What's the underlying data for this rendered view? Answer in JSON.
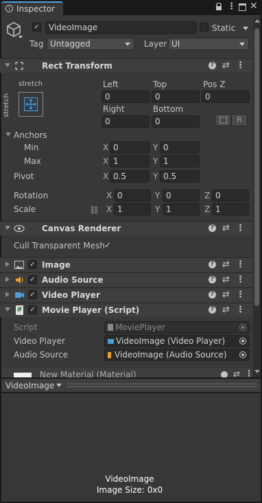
{
  "tab": {
    "title": "Inspector"
  },
  "object": {
    "name": "VideoImage",
    "static_label": "Static",
    "tag_label": "Tag",
    "tag_value": "Untagged",
    "layer_label": "Layer",
    "layer_value": "UI",
    "active": true
  },
  "rect_transform": {
    "title": "Rect Transform",
    "stretch_h": "stretch",
    "stretch_v": "stretch",
    "left_label": "Left",
    "left": "0",
    "top_label": "Top",
    "top": "0",
    "posz_label": "Pos Z",
    "posz": "0",
    "right_label": "Right",
    "right": "0",
    "bottom_label": "Bottom",
    "bottom": "0",
    "raw_button": "R",
    "anchors_label": "Anchors",
    "min_label": "Min",
    "min_x": "0",
    "min_y": "0",
    "max_label": "Max",
    "max_x": "1",
    "max_y": "1",
    "pivot_label": "Pivot",
    "pivot_x": "0.5",
    "pivot_y": "0.5",
    "rotation_label": "Rotation",
    "rot_x": "0",
    "rot_y": "0",
    "rot_z": "0",
    "scale_label": "Scale",
    "scale_x": "1",
    "scale_y": "1",
    "scale_z": "1",
    "x": "X",
    "y": "Y",
    "z": "Z"
  },
  "canvas_renderer": {
    "title": "Canvas Renderer",
    "cull_label": "Cull Transparent Mesh",
    "cull_checked": true
  },
  "components": [
    {
      "title": "Image"
    },
    {
      "title": "Audio Source"
    },
    {
      "title": "Video Player"
    }
  ],
  "movie_player": {
    "title": "Movie Player (Script)",
    "script_label": "Script",
    "script_value": "MoviePlayer",
    "video_label": "Video Player",
    "video_value": "VideoImage (Video Player)",
    "audio_label": "Audio Source",
    "audio_value": "VideoImage (Audio Source)"
  },
  "material": {
    "title": "New Material (Material)"
  },
  "preview": {
    "dropdown": "VideoImage",
    "name": "VideoImage",
    "size": "Image Size: 0x0"
  },
  "icons": {
    "lock": "lock-icon",
    "menu": "kebab-menu-icon",
    "maximize": "maximize-icon",
    "close": "close-icon",
    "cube": "gameobject-cube-icon"
  },
  "colors": {
    "background": "#383838",
    "header": "#3e3e3e",
    "field": "#2a2a2a",
    "accent_blue": "#4c9ed9",
    "audio_orange": "#e8a033"
  }
}
